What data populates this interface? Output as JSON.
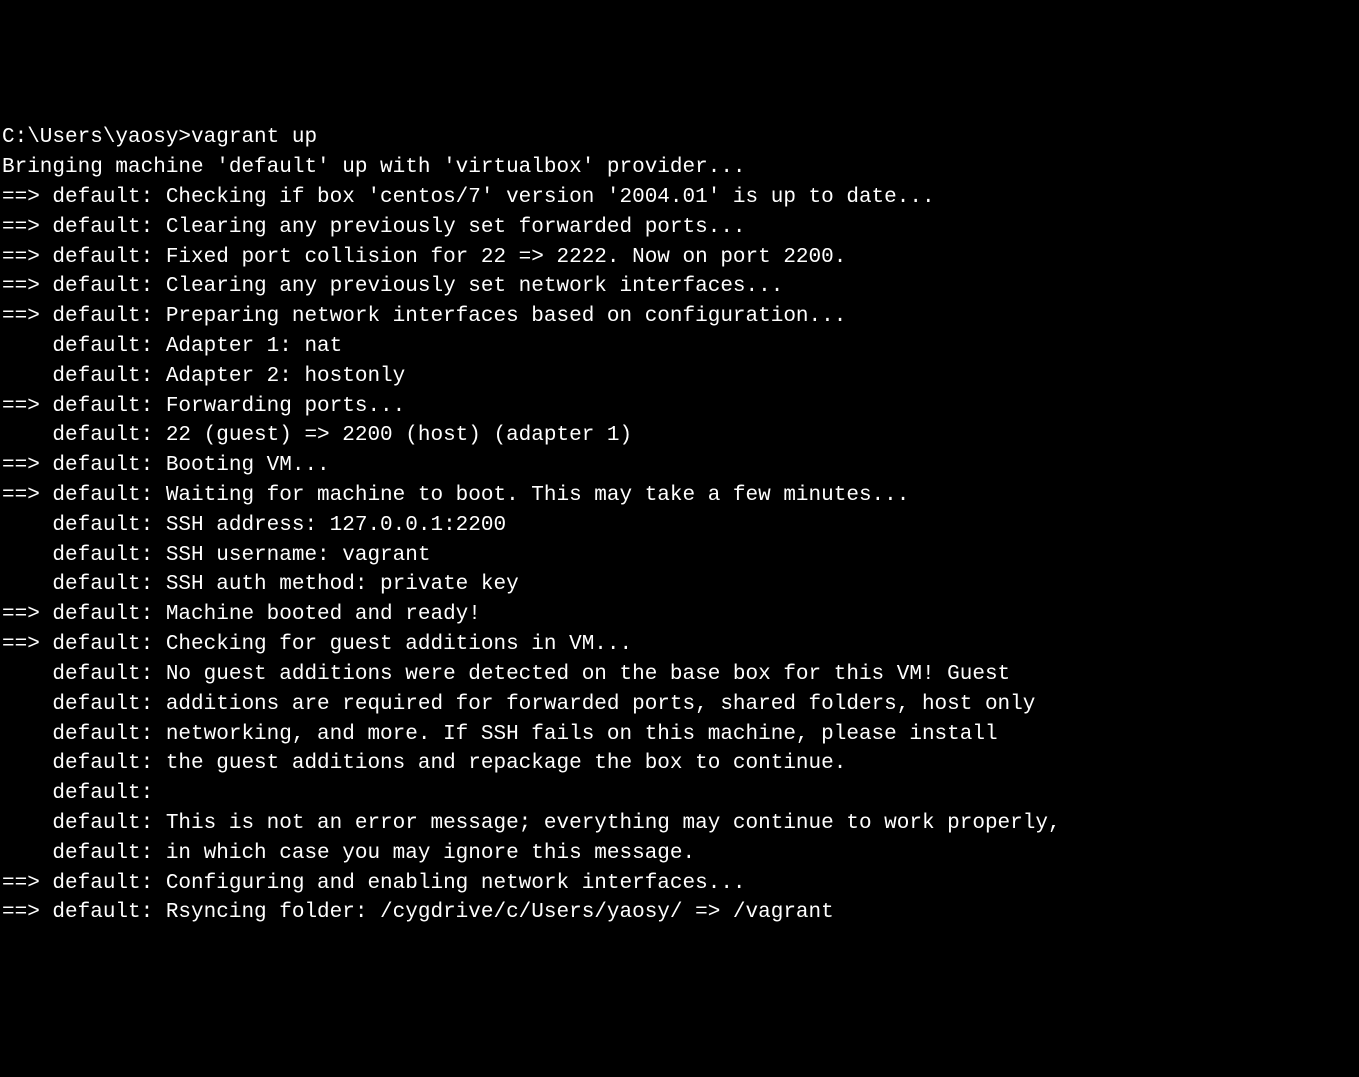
{
  "terminal": {
    "lines": [
      "C:\\Users\\yaosy>vagrant up",
      "Bringing machine 'default' up with 'virtualbox' provider...",
      "==> default: Checking if box 'centos/7' version '2004.01' is up to date...",
      "==> default: Clearing any previously set forwarded ports...",
      "==> default: Fixed port collision for 22 => 2222. Now on port 2200.",
      "==> default: Clearing any previously set network interfaces...",
      "==> default: Preparing network interfaces based on configuration...",
      "    default: Adapter 1: nat",
      "    default: Adapter 2: hostonly",
      "==> default: Forwarding ports...",
      "    default: 22 (guest) => 2200 (host) (adapter 1)",
      "==> default: Booting VM...",
      "==> default: Waiting for machine to boot. This may take a few minutes...",
      "    default: SSH address: 127.0.0.1:2200",
      "    default: SSH username: vagrant",
      "    default: SSH auth method: private key",
      "==> default: Machine booted and ready!",
      "==> default: Checking for guest additions in VM...",
      "    default: No guest additions were detected on the base box for this VM! Guest",
      "    default: additions are required for forwarded ports, shared folders, host only",
      "    default: networking, and more. If SSH fails on this machine, please install",
      "    default: the guest additions and repackage the box to continue.",
      "    default:",
      "    default: This is not an error message; everything may continue to work properly,",
      "    default: in which case you may ignore this message.",
      "==> default: Configuring and enabling network interfaces...",
      "==> default: Rsyncing folder: /cygdrive/c/Users/yaosy/ => /vagrant"
    ]
  }
}
